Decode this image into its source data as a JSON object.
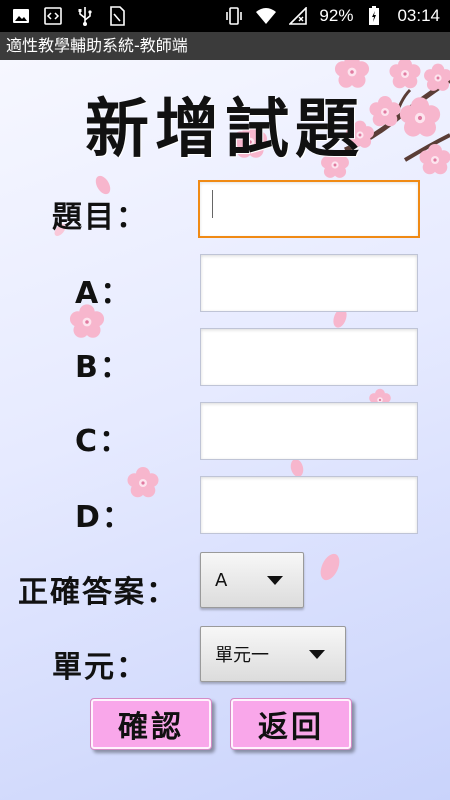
{
  "status_bar": {
    "battery": "92%",
    "time": "03:14",
    "icons_left": [
      "image-icon",
      "code-icon",
      "usb-icon",
      "sim-card-icon"
    ],
    "icons_right": [
      "vibrate-icon",
      "wifi-icon",
      "signal-icon",
      "battery-charging-icon"
    ]
  },
  "app": {
    "title": "適性教學輔助系統-教師端"
  },
  "form": {
    "page_title": "新增試題",
    "question_label": "題目：",
    "question_value": "",
    "option_a_label": "A：",
    "option_a_value": "",
    "option_b_label": "B：",
    "option_b_value": "",
    "option_c_label": "C：",
    "option_c_value": "",
    "option_d_label": "D：",
    "option_d_value": "",
    "answer_label": "正確答案：",
    "answer_selected": "A",
    "unit_label": "單元：",
    "unit_selected": "單元一",
    "confirm_label": "確認",
    "back_label": "返回"
  },
  "colors": {
    "status_bar_bg": "#000000",
    "title_bar_bg": "#3b3b3b",
    "focus_border": "#f08a14",
    "button_bg": "#f9a7ea",
    "blossom": "#f7b6cd"
  }
}
